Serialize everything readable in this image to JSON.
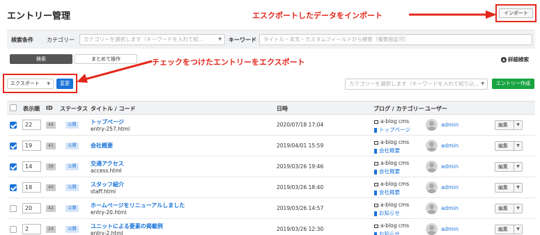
{
  "header": {
    "title": "エントリー管理",
    "import_label": "インポート"
  },
  "annotations": {
    "import_note": "エスクポートしたデータをインポート",
    "export_note": "チェックをつけたエントリーをエクスポート",
    "color": "#e4271c"
  },
  "search": {
    "conditions_label": "検索条件",
    "category_label": "カテゴリー",
    "category_placeholder": "カテゴリーを選択します（キーワードを入れて絞...",
    "keyword_label": "キーワード",
    "keyword_placeholder": "タイトル・本文・カスタムフィールドから検索（複数指定可）"
  },
  "tabs": [
    "検索",
    "まとめて操作"
  ],
  "advanced_search": "詳細検索",
  "bulk": {
    "action_value": "エクスポート",
    "apply_label": "変更"
  },
  "category_filter_placeholder": "カテゴリーを選択します（キーワードを入れて絞り込...",
  "create_label": "エントリー作成",
  "table": {
    "headers": [
      "表示順",
      "ID",
      "ステータス",
      "タイトル / コード",
      "日時",
      "ブログ / カテゴリー",
      "ユーザー"
    ],
    "rows": [
      {
        "checked": true,
        "order": "22",
        "id": "44",
        "status": "公開",
        "title": "トップページ",
        "code": "entry-257.html",
        "date": "2020/07/18 17:04",
        "blog": "a-blog cms",
        "category": "トップページ",
        "user": "admin",
        "edit": "編集"
      },
      {
        "checked": true,
        "order": "19",
        "id": "41",
        "status": "公開",
        "title": "会社概要",
        "code": "",
        "date": "2019/04/01 15:59",
        "blog": "a-blog cms",
        "category": "会社概要",
        "user": "admin",
        "edit": "編集"
      },
      {
        "checked": true,
        "order": "14",
        "id": "36",
        "status": "公開",
        "title": "交通アクセス",
        "code": "access.html",
        "date": "2019/03/26 19:46",
        "blog": "a-blog cms",
        "category": "会社概要",
        "user": "admin",
        "edit": "編集"
      },
      {
        "checked": true,
        "order": "18",
        "id": "40",
        "status": "公開",
        "title": "スタッフ紹介",
        "code": "staff.html",
        "date": "2019/03/26 18:40",
        "blog": "a-blog cms",
        "category": "会社概要",
        "user": "admin",
        "edit": "編集"
      },
      {
        "checked": false,
        "order": "20",
        "id": "42",
        "status": "公開",
        "title": "ホームページをリニューアルしました",
        "code": "entry-20.html",
        "date": "2019/03/26 14:57",
        "blog": "a-blog cms",
        "category": "お知らせ",
        "user": "admin",
        "edit": "編集"
      },
      {
        "checked": false,
        "order": "2",
        "id": "24",
        "status": "公開",
        "title": "ユニットによる要素の掲載例",
        "code": "entry-2.html",
        "date": "2019/03/26 12:30",
        "blog": "a-blog cms",
        "category": "お知らせ",
        "user": "admin",
        "edit": "編集"
      }
    ]
  }
}
